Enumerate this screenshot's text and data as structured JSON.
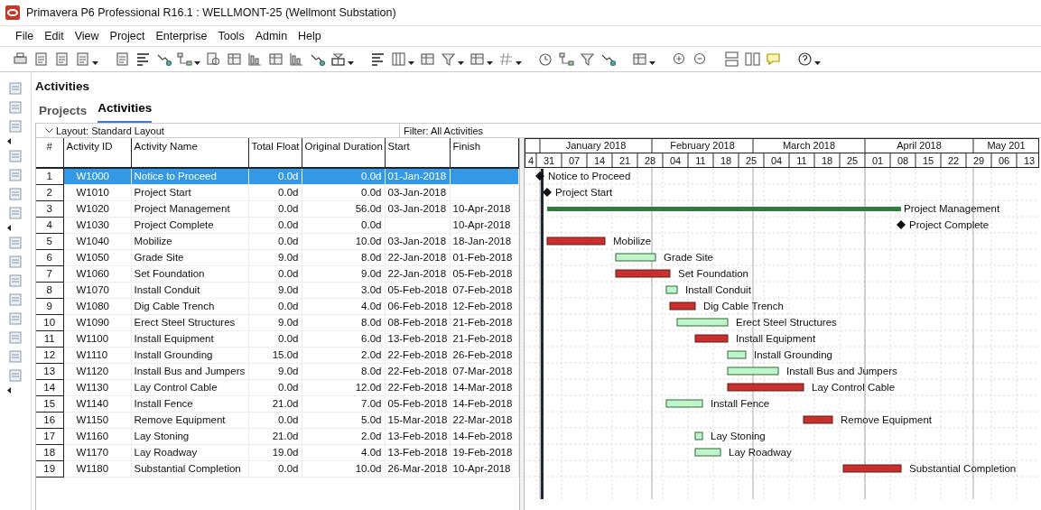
{
  "window": {
    "title": "Primavera P6 Professional R16.1 : WELLMONT-25 (Wellmont Substation)"
  },
  "menu": [
    "File",
    "Edit",
    "View",
    "Project",
    "Enterprise",
    "Tools",
    "Admin",
    "Help"
  ],
  "page_title": "Activities",
  "tabs": [
    {
      "label": "Projects",
      "selected": false
    },
    {
      "label": "Activities",
      "selected": true
    }
  ],
  "layout_bar": {
    "layout": "Layout: Standard Layout",
    "filter": "Filter: All Activities"
  },
  "table": {
    "columns": [
      "#",
      "Activity ID",
      "Activity Name",
      "Total Float",
      "Original Duration",
      "Start",
      "Finish"
    ],
    "rows": [
      {
        "num": "1",
        "id": "W1000",
        "name": "Notice to Proceed",
        "total_float": "0.0d",
        "original_duration": "0.0d",
        "start": "01-Jan-2018",
        "selected": true,
        "bar": {
          "kind": "milestone",
          "label": "Notice to Proceed"
        }
      },
      {
        "num": "2",
        "id": "W1010",
        "name": "Project Start",
        "total_float": "0.0d",
        "original_duration": "0.0d",
        "start": "03-Jan-2018",
        "selected": false,
        "bar": {
          "kind": "milestone",
          "label": "Project Start"
        }
      },
      {
        "num": "3",
        "id": "W1020",
        "name": "Project Management",
        "total_float": "0.0d",
        "original_duration": "56.0d",
        "start": "03-Jan-2018",
        "finish": "10-Apr-2018",
        "selected": false,
        "bar": {
          "kind": "level_of_effort",
          "label": "Project Management"
        }
      },
      {
        "num": "4",
        "id": "W1030",
        "name": "Project Complete",
        "total_float": "0.0d",
        "original_duration": "0.0d",
        "finish": "10-Apr-2018",
        "selected": false,
        "bar": {
          "kind": "milestone",
          "label": "Project Complete"
        }
      },
      {
        "num": "5",
        "id": "W1040",
        "name": "Mobilize",
        "total_float": "0.0d",
        "original_duration": "10.0d",
        "start": "03-Jan-2018",
        "finish": "18-Jan-2018",
        "selected": false,
        "bar": {
          "kind": "critical",
          "label": "Mobilize"
        }
      },
      {
        "num": "6",
        "id": "W1050",
        "name": "Grade Site",
        "total_float": "9.0d",
        "original_duration": "8.0d",
        "start": "22-Jan-2018",
        "finish": "01-Feb-2018",
        "selected": false,
        "bar": {
          "kind": "noncritical",
          "label": "Grade Site"
        }
      },
      {
        "num": "7",
        "id": "W1060",
        "name": "Set Foundation",
        "total_float": "0.0d",
        "original_duration": "9.0d",
        "start": "22-Jan-2018",
        "finish": "05-Feb-2018",
        "selected": false,
        "bar": {
          "kind": "critical",
          "label": "Set Foundation"
        }
      },
      {
        "num": "8",
        "id": "W1070",
        "name": "Install Conduit",
        "total_float": "9.0d",
        "original_duration": "3.0d",
        "start": "05-Feb-2018",
        "finish": "07-Feb-2018",
        "selected": false,
        "bar": {
          "kind": "noncritical",
          "label": "Install Conduit"
        }
      },
      {
        "num": "9",
        "id": "W1080",
        "name": "Dig Cable Trench",
        "total_float": "0.0d",
        "original_duration": "4.0d",
        "start": "06-Feb-2018",
        "finish": "12-Feb-2018",
        "selected": false,
        "bar": {
          "kind": "critical",
          "label": "Dig Cable Trench"
        }
      },
      {
        "num": "10",
        "id": "W1090",
        "name": "Erect Steel Structures",
        "total_float": "9.0d",
        "original_duration": "8.0d",
        "start": "08-Feb-2018",
        "finish": "21-Feb-2018",
        "selected": false,
        "bar": {
          "kind": "noncritical",
          "label": "Erect Steel Structures"
        }
      },
      {
        "num": "11",
        "id": "W1100",
        "name": "Install Equipment",
        "total_float": "0.0d",
        "original_duration": "6.0d",
        "start": "13-Feb-2018",
        "finish": "21-Feb-2018",
        "selected": false,
        "bar": {
          "kind": "critical",
          "label": "Install Equipment"
        }
      },
      {
        "num": "12",
        "id": "W1110",
        "name": "Install Grounding",
        "total_float": "15.0d",
        "original_duration": "2.0d",
        "start": "22-Feb-2018",
        "finish": "26-Feb-2018",
        "selected": false,
        "bar": {
          "kind": "noncritical",
          "label": "Install Grounding"
        }
      },
      {
        "num": "13",
        "id": "W1120",
        "name": "Install Bus and Jumpers",
        "total_float": "9.0d",
        "original_duration": "8.0d",
        "start": "22-Feb-2018",
        "finish": "07-Mar-2018",
        "selected": false,
        "bar": {
          "kind": "noncritical",
          "label": "Install Bus and Jumpers"
        }
      },
      {
        "num": "14",
        "id": "W1130",
        "name": "Lay Control Cable",
        "total_float": "0.0d",
        "original_duration": "12.0d",
        "start": "22-Feb-2018",
        "finish": "14-Mar-2018",
        "selected": false,
        "bar": {
          "kind": "critical",
          "label": "Lay Control Cable"
        }
      },
      {
        "num": "15",
        "id": "W1140",
        "name": "Install Fence",
        "total_float": "21.0d",
        "original_duration": "7.0d",
        "start": "05-Feb-2018",
        "finish": "14-Feb-2018",
        "selected": false,
        "bar": {
          "kind": "noncritical",
          "label": "Install Fence"
        }
      },
      {
        "num": "16",
        "id": "W1150",
        "name": "Remove Equipment",
        "total_float": "0.0d",
        "original_duration": "5.0d",
        "start": "15-Mar-2018",
        "finish": "22-Mar-2018",
        "selected": false,
        "bar": {
          "kind": "critical",
          "label": "Remove Equipment"
        }
      },
      {
        "num": "17",
        "id": "W1160",
        "name": "Lay Stoning",
        "total_float": "21.0d",
        "original_duration": "2.0d",
        "start": "13-Feb-2018",
        "finish": "14-Feb-2018",
        "selected": false,
        "bar": {
          "kind": "noncritical",
          "label": "Lay Stoning"
        }
      },
      {
        "num": "18",
        "id": "W1170",
        "name": "Lay Roadway",
        "total_float": "19.0d",
        "original_duration": "4.0d",
        "start": "13-Feb-2018",
        "finish": "19-Feb-2018",
        "selected": false,
        "bar": {
          "kind": "noncritical",
          "label": "Lay Roadway"
        }
      },
      {
        "num": "19",
        "id": "W1180",
        "name": "Substantial Completion",
        "total_float": "0.0d",
        "original_duration": "10.0d",
        "start": "26-Mar-2018",
        "finish": "10-Apr-2018",
        "selected": false,
        "bar": {
          "kind": "critical",
          "label": "Substantial Completion"
        }
      }
    ]
  },
  "gantt": {
    "months": [
      "January 2018",
      "February 2018",
      "March 2018",
      "April 2018",
      "May 201"
    ],
    "weeks": [
      "4",
      "31",
      "07",
      "14",
      "21",
      "28",
      "04",
      "11",
      "18",
      "25",
      "04",
      "11",
      "18",
      "25",
      "01",
      "08",
      "15",
      "22",
      "29",
      "06",
      "13"
    ]
  }
}
